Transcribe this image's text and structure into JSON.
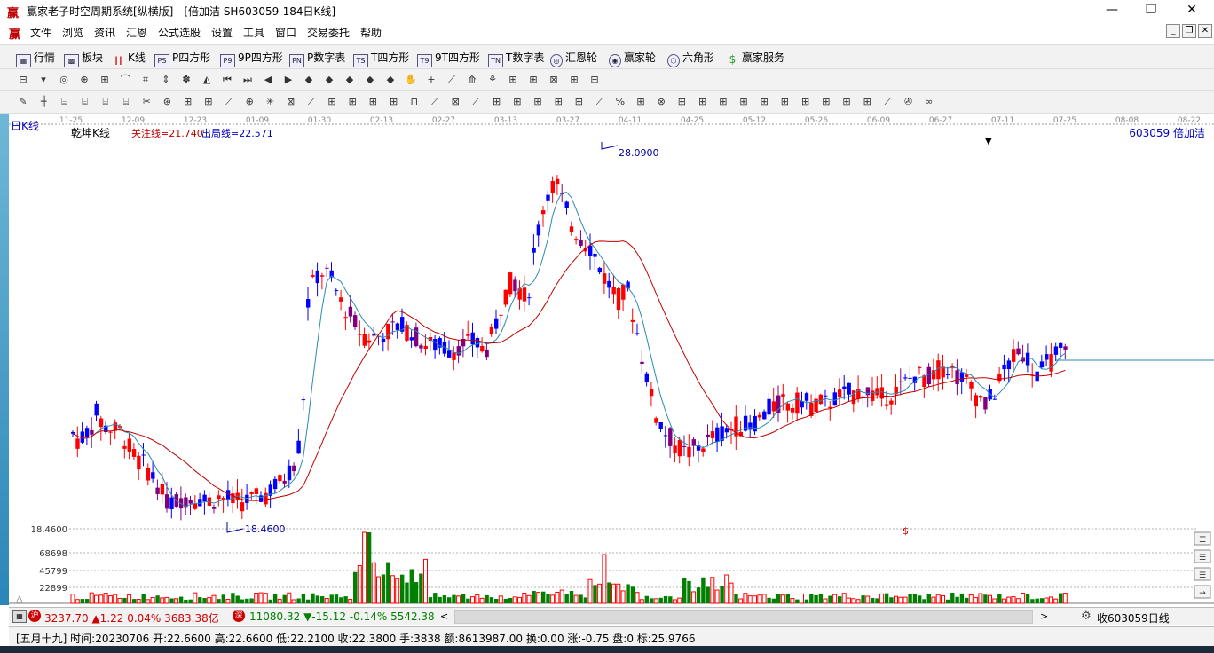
{
  "window": {
    "title": "赢家老子时空周期系统[纵横版] - [倍加洁  SH603059-184日K线]",
    "logo": "赢",
    "minimize": "—",
    "restore": "❐",
    "close": "✕"
  },
  "menu": {
    "logo": "赢",
    "items": [
      "文件",
      "浏览",
      "资讯",
      "汇恩",
      "公式选股",
      "设置",
      "工具",
      "窗口",
      "交易委托",
      "帮助"
    ],
    "mdi_buttons": [
      "_",
      "❐",
      "✕"
    ]
  },
  "toolbar1": [
    {
      "label": "行情",
      "icon": "grid-icon"
    },
    {
      "label": "板块",
      "icon": "blocks-icon"
    },
    {
      "label": "K线",
      "icon": "kline-icon"
    },
    {
      "label": "P四方形",
      "icon": "ps-icon",
      "tag": "PS"
    },
    {
      "label": "9P四方形",
      "icon": "p9-icon",
      "tag": "P9"
    },
    {
      "label": "P数字表",
      "icon": "pn-icon",
      "tag": "PN"
    },
    {
      "label": "T四方形",
      "icon": "ts-icon",
      "tag": "TS"
    },
    {
      "label": "9T四方形",
      "icon": "t9-icon",
      "tag": "T9"
    },
    {
      "label": "T数字表",
      "icon": "tn-icon",
      "tag": "TN"
    },
    {
      "label": "汇恩轮",
      "icon": "wheel-icon"
    },
    {
      "label": "赢家轮",
      "icon": "winner-wheel-icon"
    },
    {
      "label": "六角形",
      "icon": "hexagon-icon"
    },
    {
      "label": "赢家服务",
      "icon": "dollar-icon"
    }
  ],
  "chart": {
    "period_label": "日K线",
    "indicator_label": "乾坤K线",
    "focus_line": "关注线=21.740",
    "exit_line": "出局线=22.571",
    "stock_label": "603059  倍加洁",
    "high_label": "28.0900",
    "low_label": "18.4600",
    "price_axis_label": "18.4600",
    "dollar_mark": "$",
    "dates": [
      "11-25",
      "12-09",
      "12-23",
      "01-09",
      "01-30",
      "02-13",
      "02-27",
      "03-13",
      "03-27",
      "04-11",
      "04-25",
      "05-12",
      "05-26",
      "06-09",
      "06-27",
      "07-11",
      "07-25",
      "08-08",
      "08-22"
    ],
    "volume_ticks": [
      "68698",
      "45799",
      "22899"
    ]
  },
  "chart_data": {
    "type": "candlestick",
    "high": 28.09,
    "low": 18.46,
    "focus_line": 21.74,
    "exit_line": 22.571,
    "volume_ticks": [
      68698,
      45799,
      22899
    ],
    "x_ticks": [
      "11-25",
      "12-09",
      "12-23",
      "01-09",
      "01-30",
      "02-13",
      "02-27",
      "03-13",
      "03-27",
      "04-11",
      "04-25",
      "05-12",
      "05-26",
      "06-09",
      "06-27",
      "07-11",
      "07-25",
      "08-08",
      "08-22"
    ]
  },
  "status": {
    "sh_icon": "沪",
    "sh_text": "3237.70 ▲1.22 0.04% 3683.38亿",
    "sz_icon": "深",
    "sz_text": "11080.32 ▼-15.12 -0.14% 5542.38",
    "right_text": "收603059日线"
  },
  "info": {
    "text": "[五月十九] 时间:20230706 开:22.6600 高:22.6600 低:22.2100 收:22.3800 手:3838 额:8613987.00 换:0.00 涨:-0.75 盘:0 标:25.9766"
  },
  "colors": {
    "up": "#ff0000",
    "down": "#0000ff",
    "neutral": "#800080",
    "volume_down": "#008000",
    "ma_short": "#2a8bb0",
    "ma_long": "#c00000"
  }
}
